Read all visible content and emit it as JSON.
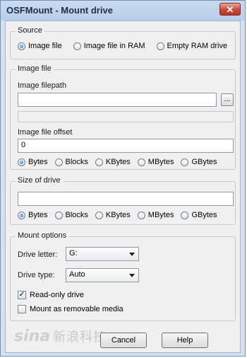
{
  "window": {
    "title": "OSFMount - Mount drive",
    "close_glyph": "✕"
  },
  "source": {
    "legend": "Source",
    "options": [
      "Image file",
      "Image file in RAM",
      "Empty RAM drive"
    ],
    "selected": 0
  },
  "image_file": {
    "legend": "Image file",
    "filepath_label": "Image filepath",
    "filepath_value": "",
    "browse_label": "...",
    "offset_label": "Image file offset",
    "offset_value": "0",
    "units": [
      "Bytes",
      "Blocks",
      "KBytes",
      "MBytes",
      "GBytes"
    ],
    "unit_selected": 0
  },
  "size_of_drive": {
    "legend": "Size of drive",
    "value": "",
    "units": [
      "Bytes",
      "Blocks",
      "KBytes",
      "MBytes",
      "GBytes"
    ],
    "unit_selected": 0
  },
  "mount_options": {
    "legend": "Mount options",
    "drive_letter_label": "Drive letter:",
    "drive_letter_value": "G:",
    "drive_type_label": "Drive type:",
    "drive_type_value": "Auto",
    "read_only_label": "Read-only drive",
    "read_only_checked": true,
    "removable_label": "Mount as removable media",
    "removable_checked": false,
    "check_glyph": "✓"
  },
  "buttons": {
    "cancel": "Cancel",
    "help": "Help"
  },
  "watermark": {
    "brand": "sina",
    "cn": "新浪科技"
  }
}
